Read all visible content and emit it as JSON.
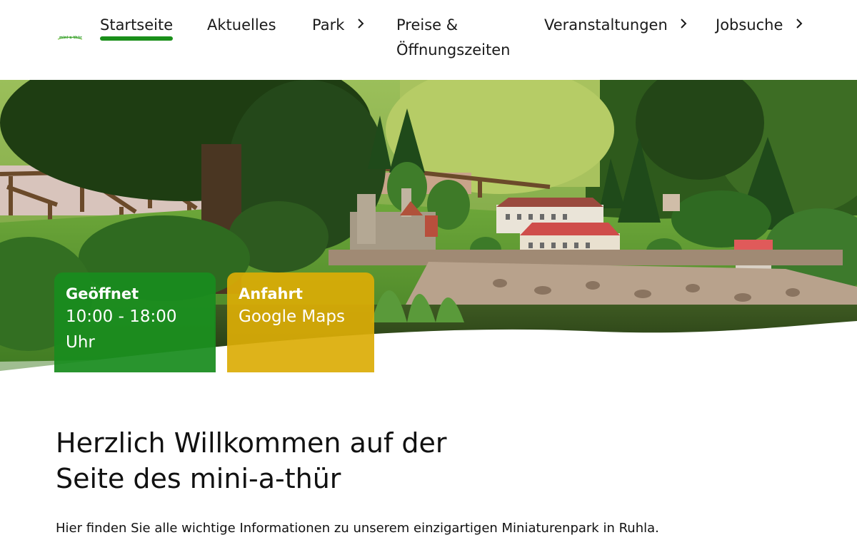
{
  "brand": {
    "logo_text": "mini-a-thür",
    "logo_color": "#2a9a2a"
  },
  "nav": {
    "items": [
      {
        "label": "Startseite",
        "active": true,
        "has_submenu": false
      },
      {
        "label": "Aktuelles",
        "active": false,
        "has_submenu": false
      },
      {
        "label": "Park",
        "active": false,
        "has_submenu": true
      },
      {
        "label_line1": "Preise &",
        "label_line2": "Öffnungszeiten",
        "active": false,
        "has_submenu": false
      },
      {
        "label": "Veranstaltungen",
        "active": false,
        "has_submenu": true
      },
      {
        "label": "Jobsuche",
        "active": false,
        "has_submenu": true
      }
    ],
    "active_color": "#1a8f1a"
  },
  "hero": {
    "cards": {
      "open": {
        "title": "Geöffnet",
        "value": "10:00 - 18:00 Uhr",
        "color": "#198c1e"
      },
      "route": {
        "title": "Anfahrt",
        "value": "Google Maps",
        "color": "#dbac06"
      }
    }
  },
  "main": {
    "heading_line1": "Herzlich Willkommen auf der",
    "heading_line2": "Seite des mini-a-thür",
    "intro": "Hier finden Sie alle wichtige Informationen zu unserem einzigartigen Miniaturenpark in Ruhla."
  }
}
